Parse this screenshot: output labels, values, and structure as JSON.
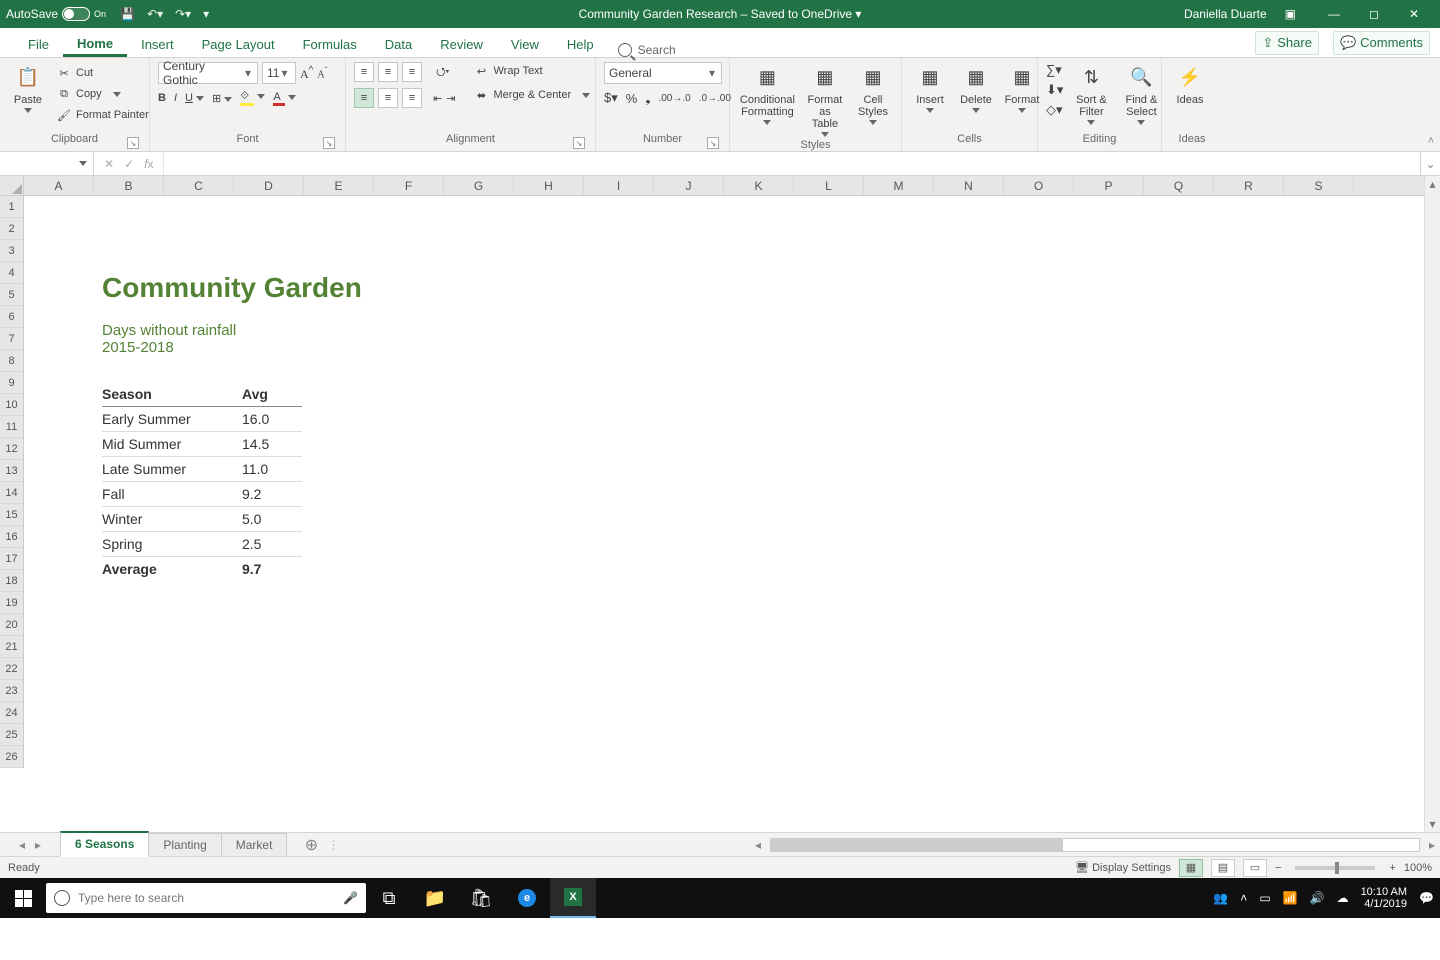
{
  "titlebar": {
    "autosave_label": "AutoSave",
    "autosave_state": "On",
    "doc_title": "Community Garden Research – Saved to OneDrive ▾",
    "user": "Daniella Duarte"
  },
  "ribbon_tabs": [
    "File",
    "Home",
    "Insert",
    "Page Layout",
    "Formulas",
    "Data",
    "Review",
    "View",
    "Help"
  ],
  "ribbon_active_tab": "Home",
  "search_placeholder": "Search",
  "share_label": "Share",
  "comments_label": "Comments",
  "ribbon": {
    "clipboard": {
      "label": "Clipboard",
      "paste": "Paste",
      "cut": "Cut",
      "copy": "Copy",
      "fp": "Format Painter"
    },
    "font": {
      "label": "Font",
      "name": "Century Gothic",
      "size": "11"
    },
    "alignment": {
      "label": "Alignment",
      "wrap": "Wrap Text",
      "merge": "Merge & Center"
    },
    "number": {
      "label": "Number",
      "format": "General"
    },
    "styles": {
      "label": "Styles",
      "cf": "Conditional Formatting",
      "fat": "Format as Table",
      "cs": "Cell Styles"
    },
    "cells": {
      "label": "Cells",
      "ins": "Insert",
      "del": "Delete",
      "fmt": "Format"
    },
    "editing": {
      "label": "Editing",
      "sort": "Sort & Filter",
      "find": "Find & Select"
    },
    "ideas": {
      "label": "Ideas",
      "btn": "Ideas"
    }
  },
  "namebox": "",
  "formula": "",
  "columns": [
    "A",
    "B",
    "C",
    "D",
    "E",
    "F",
    "G",
    "H",
    "I",
    "J",
    "K",
    "L",
    "M",
    "N",
    "O",
    "P",
    "Q",
    "R",
    "S"
  ],
  "row_count": 26,
  "sheet": {
    "title": "Community Garden",
    "sub1": "Days without rainfall",
    "sub2": "2015-2018",
    "hdr_season": "Season",
    "hdr_avg": "Avg",
    "rows": [
      {
        "s": "Early Summer",
        "v": "16.0"
      },
      {
        "s": "Mid Summer",
        "v": "14.5"
      },
      {
        "s": "Late Summer",
        "v": "11.0"
      },
      {
        "s": "Fall",
        "v": "9.2"
      },
      {
        "s": "Winter",
        "v": "5.0"
      },
      {
        "s": "Spring",
        "v": "2.5"
      }
    ],
    "avg_label": "Average",
    "avg_val": "9.7"
  },
  "sheet_tabs": [
    "6 Seasons",
    "Planting",
    "Market"
  ],
  "sheet_active": "6 Seasons",
  "status_left": "Ready",
  "display_settings": "Display Settings",
  "zoom_pct": "100%",
  "taskbar": {
    "search_placeholder": "Type here to search",
    "time": "10:10 AM",
    "date": "4/1/2019"
  },
  "chart_data": {
    "type": "table",
    "title": "Community Garden — Days without rainfall 2015-2018",
    "columns": [
      "Season",
      "Avg"
    ],
    "rows": [
      [
        "Early Summer",
        16.0
      ],
      [
        "Mid Summer",
        14.5
      ],
      [
        "Late Summer",
        11.0
      ],
      [
        "Fall",
        9.2
      ],
      [
        "Winter",
        5.0
      ],
      [
        "Spring",
        2.5
      ]
    ],
    "summary": {
      "Average": 9.7
    }
  }
}
